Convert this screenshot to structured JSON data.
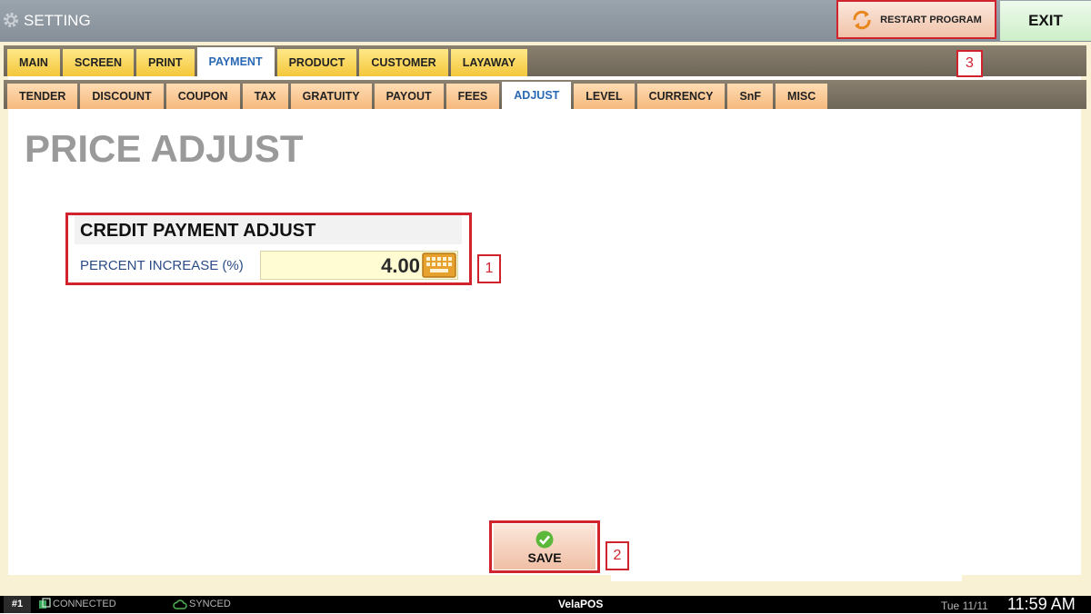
{
  "titlebar": {
    "title": "SETTING",
    "restart_label": "RESTART PROGRAM",
    "exit_label": "EXIT"
  },
  "tabs_primary": [
    "MAIN",
    "SCREEN",
    "PRINT",
    "PAYMENT",
    "PRODUCT",
    "CUSTOMER",
    "LAYAWAY"
  ],
  "tabs_secondary": [
    "TENDER",
    "DISCOUNT",
    "COUPON",
    "TAX",
    "GRATUITY",
    "PAYOUT",
    "FEES",
    "ADJUST",
    "LEVEL",
    "CURRENCY",
    "SnF",
    "MISC"
  ],
  "active_primary_tab": "PAYMENT",
  "active_secondary_tab": "ADJUST",
  "page": {
    "title": "PRICE ADJUST",
    "group_title": "CREDIT PAYMENT ADJUST",
    "field_label": "PERCENT INCREASE (%)",
    "field_value": "4.00",
    "save_label": "SAVE"
  },
  "callouts": {
    "c1": "1",
    "c2": "2",
    "c3": "3"
  },
  "taskbar": {
    "station": "#1",
    "connection": "CONNECTED",
    "sync": "SYNCED",
    "app_prefix": "Vela",
    "app_suffix": "POS",
    "date": "Tue 11/11",
    "time": "11:59 AM"
  },
  "colors": {
    "callout_red": "#d0232e",
    "tab_primary": "#f3c73a",
    "tab_secondary": "#f6b97d",
    "active_tab_text": "#2a68b4",
    "field_label_blue": "#2b4c86"
  },
  "icons": [
    "gear-icon",
    "restart-icon",
    "keyboard-icon",
    "checkmark-icon",
    "connection-icon",
    "cloud-icon"
  ]
}
